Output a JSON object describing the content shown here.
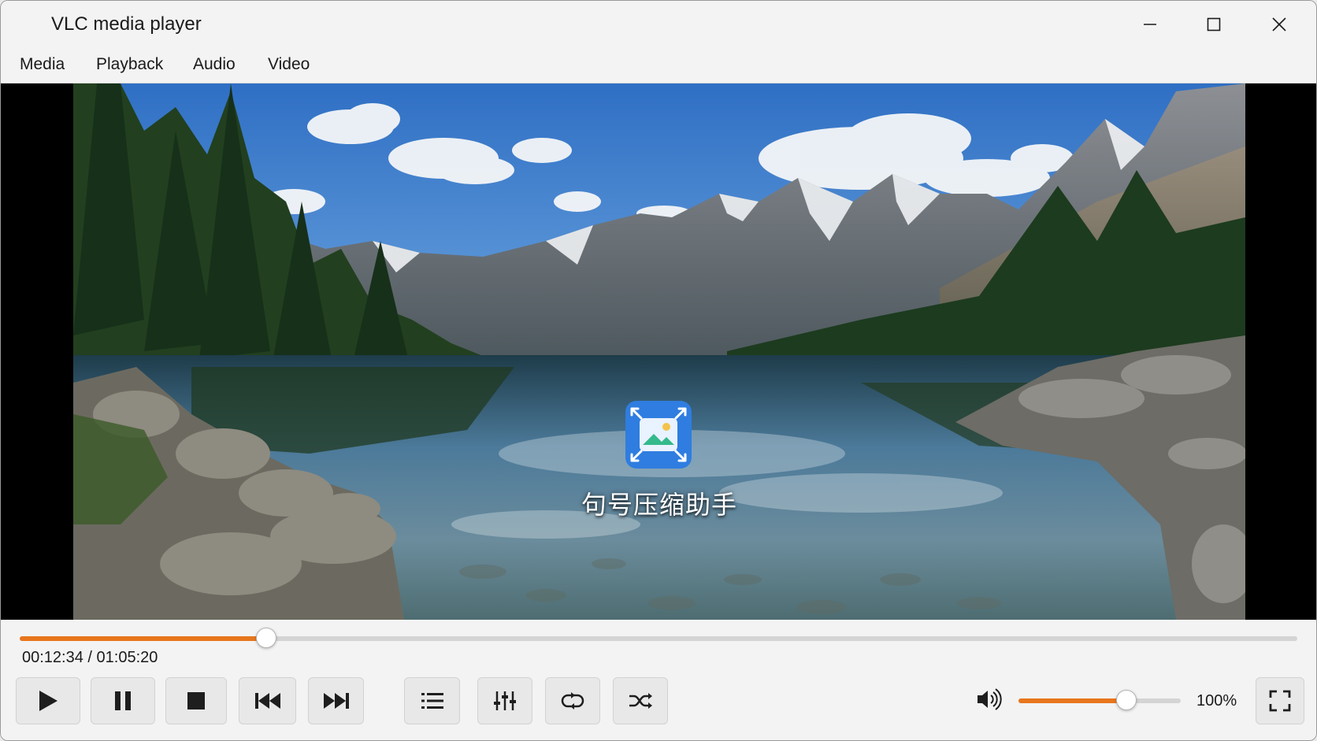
{
  "window": {
    "title": "VLC media player"
  },
  "menu": {
    "items": [
      "Media",
      "Playback",
      "Audio",
      "Video"
    ]
  },
  "video": {
    "overlay_text": "句号压缩助手",
    "overlay_logo": "image-compress-logo"
  },
  "playback": {
    "current_time": "00:12:34",
    "separator": " / ",
    "total_time": "01:05:20",
    "progress": 0.1924
  },
  "controls": {
    "buttons": [
      "play-icon",
      "pause-icon",
      "stop-icon",
      "previous-icon",
      "next-icon",
      "playlist-icon",
      "equalizer-icon",
      "loop-icon",
      "shuffle-icon",
      "fullscreen-icon"
    ]
  },
  "volume": {
    "label": "100%",
    "level": 0.66
  },
  "colors": {
    "accent": "#e8761d",
    "background": "#f3f3f3",
    "button": "#e8e8e8"
  }
}
